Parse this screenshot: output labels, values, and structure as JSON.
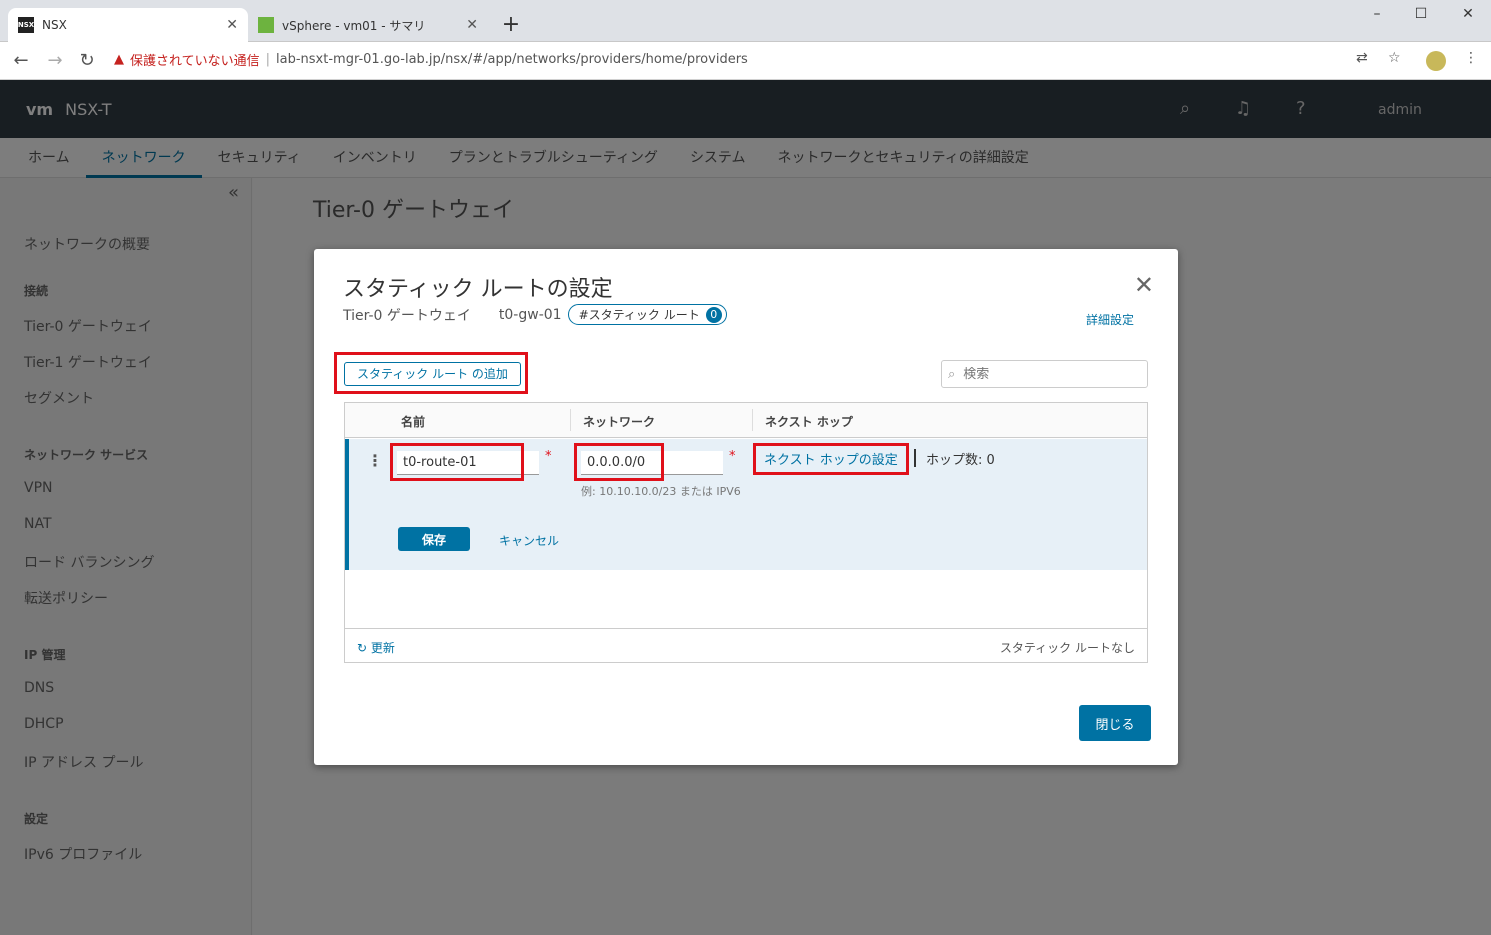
{
  "browser": {
    "tabs": [
      {
        "label": "NSX",
        "favicon": "NSX"
      },
      {
        "label": "vSphere - vm01 - サマリ"
      }
    ],
    "security_warning": "保護されていない通信",
    "url": "lab-nsxt-mgr-01.go-lab.jp/nsx/#/app/networks/providers/home/providers"
  },
  "app": {
    "logo": "vm",
    "title": "NSX-T",
    "user": "admin",
    "nav": [
      "ホーム",
      "ネットワーク",
      "セキュリティ",
      "インベントリ",
      "プランとトラブルシューティング",
      "システム",
      "ネットワークとセキュリティの詳細設定"
    ],
    "page_title": "Tier-0 ゲートウェイ",
    "sidebar": {
      "overview": "ネットワークの概要",
      "connect_head": "接続",
      "connect": [
        "Tier-0 ゲートウェイ",
        "Tier-1 ゲートウェイ",
        "セグメント"
      ],
      "services_head": "ネットワーク サービス",
      "services": [
        "VPN",
        "NAT",
        "ロード バランシング",
        "転送ポリシー"
      ],
      "ip_head": "IP 管理",
      "ip": [
        "DNS",
        "DHCP",
        "IP アドレス プール"
      ],
      "settings_head": "設定",
      "settings": [
        "IPv6 プロファイル"
      ]
    }
  },
  "modal": {
    "title": "スタティック ルートの設定",
    "subtitle_type": "Tier-0 ゲートウェイ",
    "subtitle_gw": "t0-gw-01",
    "pill_label": "#スタティック ルート",
    "pill_count": "0",
    "advanced": "詳細設定",
    "add_button": "スタティック ルート の追加",
    "search_placeholder": "検索",
    "columns": {
      "name": "名前",
      "network": "ネットワーク",
      "nexthop": "ネクスト ホップ"
    },
    "row": {
      "name": "t0-route-01",
      "network": "0.0.0.0/0",
      "network_hint": "例: 10.10.10.0/23 または IPV6",
      "nexthop_link": "ネクスト ホップの設定",
      "hop_count": "ホップ数: 0"
    },
    "save": "保存",
    "cancel": "キャンセル",
    "refresh": "更新",
    "empty": "スタティック ルートなし",
    "close": "閉じる"
  }
}
